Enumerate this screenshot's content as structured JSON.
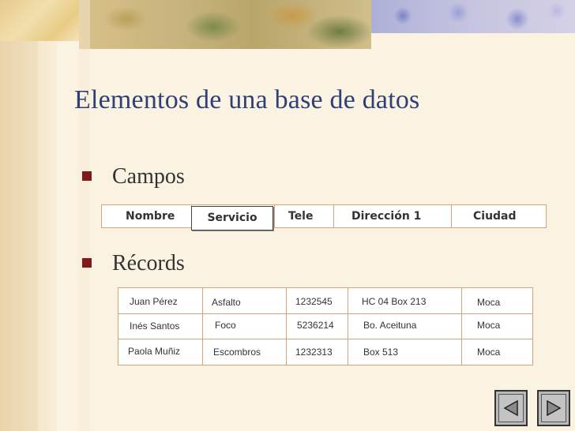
{
  "slide": {
    "title": "Elementos de una base de datos",
    "bullets": [
      "Campos",
      "Récords"
    ]
  },
  "fields_table": {
    "headers": [
      "Nombre",
      "Servicio",
      "Tele",
      "Dirección 1",
      "Ciudad"
    ]
  },
  "records_table": {
    "rows": [
      [
        "Juan Pérez",
        "Asfalto",
        "1232545",
        "HC 04 Box 213",
        "Moca"
      ],
      [
        "Inés Santos",
        "Foco",
        "5236214",
        "Bo. Aceituna",
        "Moca"
      ],
      [
        "Paola Muñiz",
        "Escombros",
        "1232313",
        "Box 513",
        "Moca"
      ]
    ]
  },
  "navigation": {
    "prev_icon": "triangle-left-icon",
    "next_icon": "triangle-right-icon"
  },
  "colors": {
    "title": "#2f3f78",
    "bullet": "#7e1a1a",
    "table_border": "#d7a27a",
    "background": "#fbf3e2"
  }
}
